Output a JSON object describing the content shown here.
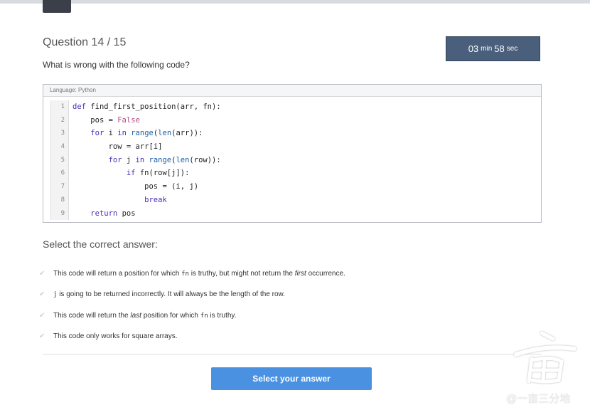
{
  "header": {
    "question_counter": "Question 14 / 15",
    "timer": {
      "minutes": "03",
      "min_label": "min",
      "seconds": "58",
      "sec_label": "sec"
    }
  },
  "question": {
    "text": "What is wrong with the following code?",
    "language_label": "Language: Python",
    "line_numbers": [
      "1",
      "2",
      "3",
      "4",
      "5",
      "6",
      "7",
      "8",
      "9"
    ],
    "code_lines": [
      "def find_first_position(arr, fn):",
      "    pos = False",
      "    for i in range(len(arr)):",
      "        row = arr[i]",
      "        for j in range(len(row)):",
      "            if fn(row[j]):",
      "                pos = (i, j)",
      "                break",
      "    return pos"
    ]
  },
  "answers_section": {
    "label": "Select the correct answer:",
    "options": [
      {
        "pre": "This code will return a position for which ",
        "code": "fn",
        "post": " is truthy, but might not return the ",
        "em": "first",
        "post2": " occurrence."
      },
      {
        "code": "j",
        "post": " is going to be returned incorrectly. It will always be the length of the row."
      },
      {
        "pre": "This code will return the ",
        "em": "last",
        "post": " position for which ",
        "code": "fn",
        "post2": " is truthy."
      },
      {
        "pre": "This code only works for square arrays."
      }
    ]
  },
  "submit": {
    "label": "Select your answer"
  },
  "watermark": {
    "text": "@一亩三分地"
  },
  "colors": {
    "timer_bg": "#4a5f7c",
    "button": "#4b91e2",
    "keyword": "#4b2cb8",
    "bool": "#b34c85"
  }
}
